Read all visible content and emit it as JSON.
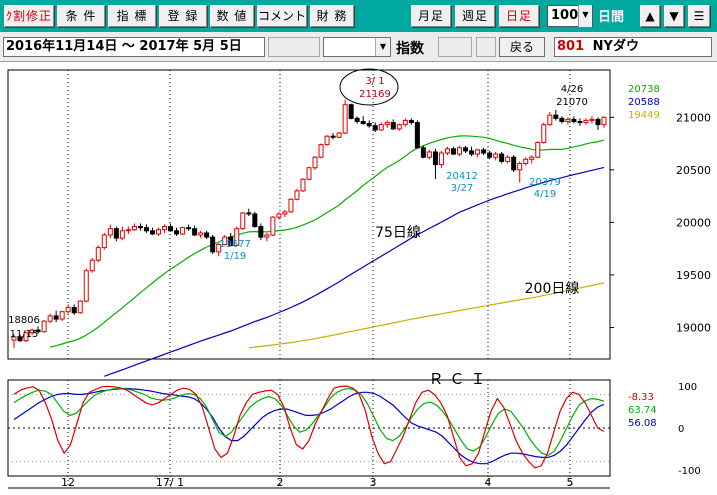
{
  "toolbar": {
    "btn_split": "ｸ割修正",
    "btn_cond": "条 件",
    "btn_index": "指 標",
    "btn_register": "登 録",
    "btn_values": "数 値",
    "btn_comment": "コメント",
    "btn_finance": "財 務",
    "btn_monthly": "月足",
    "btn_weekly": "週足",
    "btn_daily": "日足",
    "period_value": "100",
    "period_unit": "日間",
    "up": "▲",
    "down": "▼",
    "menu": "☰",
    "colors": {
      "bg": "#00a9a0",
      "active": "#d00000"
    }
  },
  "bar2": {
    "range": "2016年11月14日 〜 2017年 5月 5日",
    "index_label": "指数",
    "back_label": "戻る",
    "code": "801",
    "name": "NYダウ"
  },
  "chart_data": [
    {
      "type": "candlestick",
      "x_labels": [
        "12",
        "17/ 1",
        "2",
        "3",
        "4",
        "5"
      ],
      "y_ticks": [
        "21000",
        "20500",
        "20000",
        "19500",
        "19000"
      ],
      "ylim": [
        18700,
        21450
      ],
      "ma_legend": [
        "20738",
        "20588",
        "19449"
      ],
      "annotations": [
        {
          "text1": "18806",
          "text2": "11/15"
        },
        {
          "text1": "19677",
          "text2": "1/19"
        },
        {
          "text1": "3/ 1",
          "text2": "21169"
        },
        {
          "text1": "20412",
          "text2": "3/27"
        },
        {
          "text1": "20379",
          "text2": "4/19"
        },
        {
          "text1": "4/26",
          "text2": "21070"
        }
      ],
      "ma_labels": [
        "75日線",
        "200日線"
      ],
      "candles": [
        [
          18880,
          18935,
          18806,
          18910
        ],
        [
          18910,
          18935,
          18860,
          18875
        ],
        [
          18875,
          18960,
          18860,
          18950
        ],
        [
          18950,
          18990,
          18930,
          18975
        ],
        [
          18975,
          19010,
          18940,
          18960
        ],
        [
          18960,
          19070,
          18950,
          19060
        ],
        [
          19060,
          19130,
          19040,
          19110
        ],
        [
          19110,
          19160,
          19050,
          19080
        ],
        [
          19080,
          19160,
          19060,
          19150
        ],
        [
          19150,
          19220,
          19130,
          19190
        ],
        [
          19190,
          19220,
          19120,
          19140
        ],
        [
          19140,
          19260,
          19130,
          19250
        ],
        [
          19250,
          19560,
          19240,
          19540
        ],
        [
          19540,
          19660,
          19520,
          19640
        ],
        [
          19640,
          19780,
          19620,
          19760
        ],
        [
          19760,
          19900,
          19740,
          19880
        ],
        [
          19880,
          19980,
          19850,
          19940
        ],
        [
          19940,
          19960,
          19820,
          19850
        ],
        [
          19850,
          19960,
          19830,
          19920
        ],
        [
          19920,
          19960,
          19890,
          19930
        ],
        [
          19930,
          19990,
          19920,
          19960
        ],
        [
          19960,
          19990,
          19920,
          19950
        ],
        [
          19950,
          19980,
          19900,
          19920
        ],
        [
          19920,
          19950,
          19880,
          19890
        ],
        [
          19890,
          19950,
          19870,
          19930
        ],
        [
          19930,
          19980,
          19900,
          19960
        ],
        [
          19960,
          19990,
          19910,
          19920
        ],
        [
          19920,
          19950,
          19870,
          19890
        ],
        [
          19890,
          19960,
          19880,
          19950
        ],
        [
          19950,
          19980,
          19920,
          19940
        ],
        [
          19940,
          19970,
          19870,
          19880
        ],
        [
          19880,
          19920,
          19850,
          19900
        ],
        [
          19900,
          19920,
          19840,
          19860
        ],
        [
          19860,
          19880,
          19700,
          19720
        ],
        [
          19720,
          19800,
          19677,
          19790
        ],
        [
          19790,
          19880,
          19780,
          19860
        ],
        [
          19860,
          19900,
          19770,
          19780
        ],
        [
          19780,
          19960,
          19770,
          19940
        ],
        [
          19940,
          20100,
          19930,
          20090
        ],
        [
          20090,
          20130,
          20060,
          20080
        ],
        [
          20080,
          20100,
          19950,
          19960
        ],
        [
          19960,
          19990,
          19830,
          19860
        ],
        [
          19860,
          19900,
          19820,
          19880
        ],
        [
          19880,
          20060,
          19870,
          20050
        ],
        [
          20050,
          20100,
          20030,
          20080
        ],
        [
          20080,
          20120,
          20050,
          20100
        ],
        [
          20100,
          20230,
          20090,
          20220
        ],
        [
          20220,
          20320,
          20210,
          20300
        ],
        [
          20300,
          20420,
          20290,
          20410
        ],
        [
          20410,
          20530,
          20400,
          20520
        ],
        [
          20520,
          20630,
          20500,
          20620
        ],
        [
          20620,
          20750,
          20610,
          20740
        ],
        [
          20740,
          20830,
          20730,
          20820
        ],
        [
          20820,
          20850,
          20790,
          20810
        ],
        [
          20810,
          20860,
          20800,
          20850
        ],
        [
          20850,
          21169,
          20840,
          21120
        ],
        [
          21120,
          21130,
          20980,
          20990
        ],
        [
          20990,
          21010,
          20940,
          20960
        ],
        [
          20960,
          21010,
          20930,
          20940
        ],
        [
          20940,
          20970,
          20900,
          20920
        ],
        [
          20920,
          20950,
          20860,
          20880
        ],
        [
          20880,
          20950,
          20870,
          20930
        ],
        [
          20930,
          20970,
          20900,
          20950
        ],
        [
          20950,
          20980,
          20880,
          20890
        ],
        [
          20890,
          20940,
          20870,
          20930
        ],
        [
          20930,
          20990,
          20910,
          20970
        ],
        [
          20970,
          20990,
          20930,
          20950
        ],
        [
          20950,
          20970,
          20700,
          20710
        ],
        [
          20710,
          20730,
          20610,
          20620
        ],
        [
          20620,
          20690,
          20600,
          20670
        ],
        [
          20670,
          20700,
          20412,
          20550
        ],
        [
          20550,
          20680,
          20520,
          20660
        ],
        [
          20660,
          20720,
          20640,
          20700
        ],
        [
          20700,
          20720,
          20640,
          20650
        ],
        [
          20650,
          20730,
          20630,
          20710
        ],
        [
          20710,
          20730,
          20660,
          20680
        ],
        [
          20680,
          20720,
          20630,
          20650
        ],
        [
          20650,
          20700,
          20620,
          20690
        ],
        [
          20690,
          20710,
          20640,
          20660
        ],
        [
          20660,
          20680,
          20600,
          20620
        ],
        [
          20620,
          20670,
          20590,
          20650
        ],
        [
          20650,
          20670,
          20560,
          20580
        ],
        [
          20580,
          20640,
          20560,
          20620
        ],
        [
          20620,
          20640,
          20480,
          20500
        ],
        [
          20500,
          20580,
          20379,
          20560
        ],
        [
          20560,
          20620,
          20540,
          20600
        ],
        [
          20600,
          20640,
          20560,
          20620
        ],
        [
          20620,
          20770,
          20610,
          20760
        ],
        [
          20760,
          20950,
          20750,
          20930
        ],
        [
          20930,
          21050,
          20920,
          21020
        ],
        [
          21020,
          21070,
          20970,
          20990
        ],
        [
          20990,
          21010,
          20940,
          20960
        ],
        [
          20960,
          21000,
          20930,
          20980
        ],
        [
          20980,
          21010,
          20940,
          20960
        ],
        [
          20960,
          20990,
          20920,
          20950
        ],
        [
          20950,
          20990,
          20930,
          20970
        ],
        [
          20970,
          21010,
          20940,
          20980
        ],
        [
          20980,
          21000,
          20880,
          20930
        ],
        [
          20930,
          21010,
          20900,
          21000
        ]
      ]
    },
    {
      "type": "line",
      "title": "ＲＣＩ",
      "y_ticks": [
        "100",
        "0",
        "-100"
      ],
      "ylim": [
        -100,
        100
      ],
      "legend_values": [
        "-8.33",
        "63.74",
        "56.08"
      ],
      "series_red": [
        80,
        90,
        95,
        98,
        90,
        60,
        20,
        -30,
        -60,
        -40,
        10,
        60,
        85,
        92,
        98,
        99,
        98,
        95,
        90,
        80,
        70,
        60,
        55,
        60,
        70,
        80,
        90,
        95,
        92,
        80,
        50,
        0,
        -50,
        -70,
        -60,
        -20,
        30,
        60,
        80,
        85,
        88,
        90,
        80,
        50,
        0,
        -40,
        -50,
        -30,
        10,
        40,
        70,
        95,
        99,
        100,
        95,
        80,
        40,
        -20,
        -60,
        -85,
        -80,
        -50,
        -20,
        20,
        60,
        85,
        90,
        80,
        60,
        30,
        -20,
        -70,
        -90,
        -85,
        -60,
        -10,
        40,
        70,
        50,
        10,
        -30,
        -60,
        -80,
        -95,
        -90,
        -60,
        -10,
        40,
        70,
        85,
        80,
        60,
        30,
        0,
        -8.33
      ],
      "series_green": [
        60,
        70,
        78,
        85,
        90,
        88,
        80,
        60,
        40,
        30,
        35,
        50,
        65,
        78,
        85,
        90,
        93,
        94,
        93,
        90,
        85,
        80,
        72,
        68,
        66,
        68,
        72,
        78,
        82,
        80,
        70,
        50,
        20,
        -10,
        -20,
        -10,
        10,
        30,
        50,
        62,
        70,
        75,
        70,
        55,
        30,
        5,
        -10,
        -5,
        10,
        30,
        50,
        72,
        85,
        92,
        94,
        90,
        78,
        55,
        25,
        -5,
        -25,
        -30,
        -20,
        0,
        25,
        45,
        58,
        62,
        55,
        40,
        20,
        -5,
        -30,
        -50,
        -55,
        -45,
        -20,
        10,
        35,
        45,
        40,
        20,
        0,
        -25,
        -45,
        -60,
        -65,
        -55,
        -30,
        0,
        30,
        55,
        65,
        70,
        68,
        63.74
      ],
      "series_blue": [
        20,
        30,
        40,
        50,
        60,
        68,
        75,
        80,
        82,
        82,
        80,
        80,
        82,
        85,
        88,
        90,
        92,
        93,
        94,
        93,
        92,
        90,
        88,
        85,
        82,
        80,
        78,
        76,
        74,
        70,
        60,
        45,
        25,
        0,
        -20,
        -30,
        -30,
        -20,
        -5,
        10,
        25,
        35,
        42,
        45,
        45,
        40,
        35,
        30,
        30,
        32,
        38,
        45,
        55,
        65,
        75,
        82,
        85,
        85,
        82,
        75,
        65,
        55,
        40,
        25,
        12,
        5,
        0,
        -5,
        -10,
        -20,
        -35,
        -50,
        -65,
        -75,
        -82,
        -85,
        -85,
        -80,
        -72,
        -65,
        -60,
        -60,
        -62,
        -65,
        -68,
        -70,
        -70,
        -65,
        -55,
        -40,
        -20,
        0,
        20,
        38,
        50,
        56.08
      ]
    }
  ]
}
